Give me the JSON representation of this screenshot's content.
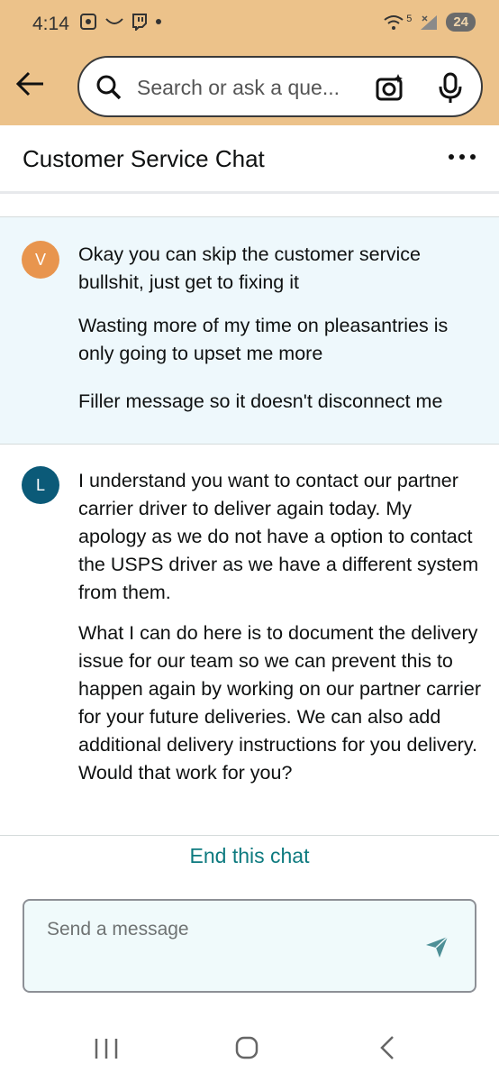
{
  "status_bar": {
    "time": "4:14",
    "network_tag": "5",
    "battery": "24"
  },
  "search": {
    "placeholder": "Search or ask a que..."
  },
  "chat_header": {
    "title": "Customer Service Chat"
  },
  "messages": [
    {
      "sender_initial": "V",
      "paragraphs": [
        "Okay you can skip the customer service bullshit, just get to fixing it",
        "Wasting more of my time on pleasantries is only going to upset me more",
        "Filler message so it doesn't disconnect me"
      ]
    },
    {
      "sender_initial": "L",
      "paragraphs": [
        "I understand you want to contact our partner carrier driver to deliver again today. My apology as we do not have a option to contact the USPS driver as we have a different system from them.",
        "What I can do here is to document the delivery issue for our team so we can prevent this to happen again by working on our partner carrier for your future deliveries. We can also add additional delivery instructions for you delivery. Would that work for you?"
      ]
    }
  ],
  "end_chat": {
    "label": "End this chat"
  },
  "composer": {
    "placeholder": "Send a message"
  },
  "colors": {
    "header_bg": "#ecc28a",
    "user_msg_bg": "#eef8fc",
    "avatar_v": "#e8954e",
    "avatar_l": "#0b5a78",
    "link": "#0d7a7f"
  }
}
